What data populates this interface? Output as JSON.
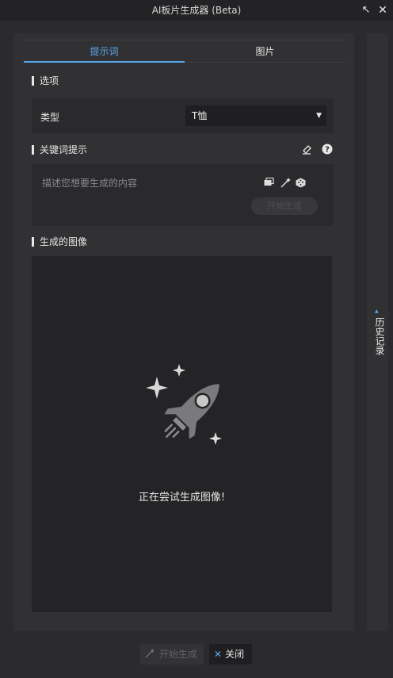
{
  "window": {
    "title": "AI板片生成器 (Beta)",
    "pin_icon": "↖",
    "close_icon": "✕"
  },
  "tabs": [
    {
      "label": "提示词",
      "active": true
    },
    {
      "label": "图片",
      "active": false
    }
  ],
  "options_section": {
    "title": "选项",
    "type_label": "类型",
    "type_value": "T恤",
    "dropdown_icon": "▼"
  },
  "keyword_section": {
    "title": "关键词提示",
    "eraser_icon": "eraser",
    "help_icon": "?",
    "placeholder": "描述您想要生成的内容",
    "tools": [
      "chat-icon",
      "magic-wand-icon",
      "dice-icon"
    ],
    "generate_label": "开始生成"
  },
  "generated_section": {
    "title": "生成的图像",
    "status": "正在尝试生成图像!"
  },
  "history_tab": {
    "label": "历史记录"
  },
  "footer": {
    "start_label": "开始生成",
    "close_label": "关闭"
  },
  "colors": {
    "accent": "#5aa9ee",
    "background": "#2b2b2d",
    "panel": "#313133"
  }
}
